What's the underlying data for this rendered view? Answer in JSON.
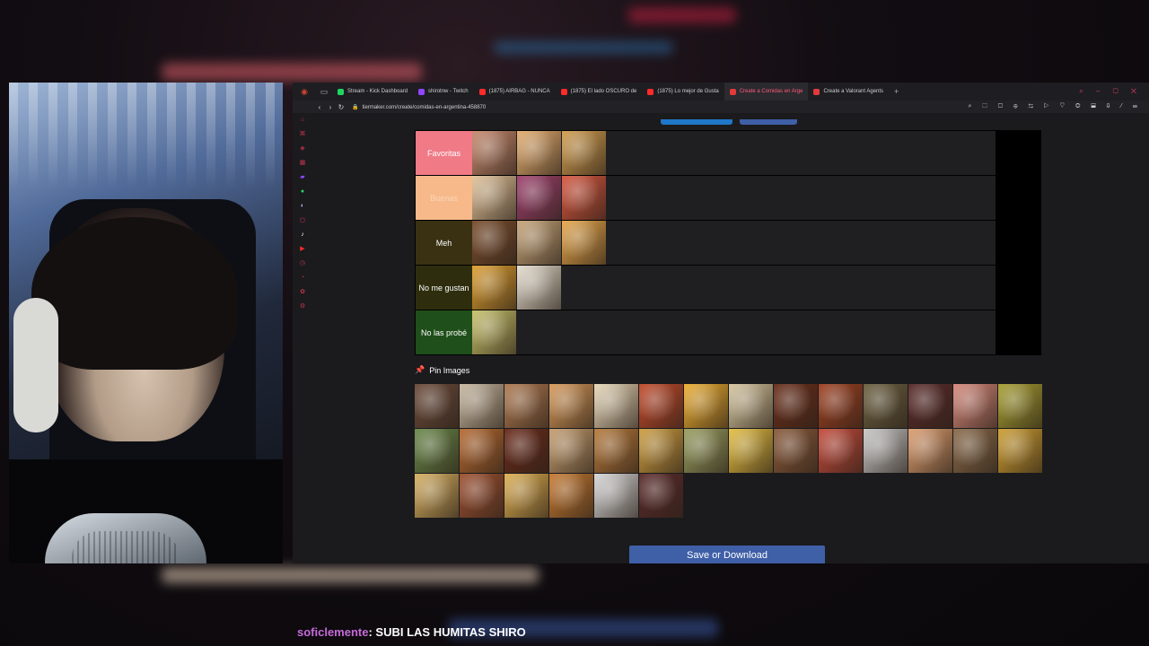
{
  "browser": {
    "tabs": [
      {
        "label": "Stream - Kick Dashboard",
        "fav": "#1ed760",
        "active": false
      },
      {
        "label": "shirotnw - Twitch",
        "fav": "#9146ff",
        "active": false
      },
      {
        "label": "(1875) AIRBAG - NUNCA",
        "fav": "#ff2a2a",
        "active": false
      },
      {
        "label": "(1875) El lado OSCURO de",
        "fav": "#ff2a2a",
        "active": false
      },
      {
        "label": "(1875) Lo mejor de Gusta",
        "fav": "#ff2a2a",
        "active": false
      },
      {
        "label": "Create a Comidas en Arge",
        "fav": "#e03a3a",
        "active": true
      },
      {
        "label": "Create a Valorant Agents",
        "fav": "#e03a3a",
        "active": false
      }
    ],
    "url": "tiermaker.com/create/comidas-en-argentina-458870"
  },
  "tiers": [
    {
      "label": "Favoritas",
      "color": "#f07a86",
      "items": [
        "#c88a6e",
        "#e8b070",
        "#d4a050"
      ]
    },
    {
      "label": "Buenas",
      "color": "#f7b98a",
      "items": [
        "#e3c49b",
        "#a0406e",
        "#d9563e"
      ]
    },
    {
      "label": "Meh",
      "color": "#3a3112",
      "items": [
        "#7a4d2d",
        "#c9a77a",
        "#e9a84a"
      ]
    },
    {
      "label": "No me gustan",
      "color": "#2e2e0f",
      "items": [
        "#e0a030",
        "#e8e0d0"
      ]
    },
    {
      "label": "No las probé",
      "color": "#1f4f1a",
      "items": [
        "#c9c36a"
      ]
    }
  ],
  "pin_images_label": "Pin Images",
  "pool_items": [
    "#6b4a3a",
    "#c8b8a0",
    "#b07a50",
    "#d99a5a",
    "#e8d8b8",
    "#c54a2a",
    "#f0b030",
    "#d8c8a0",
    "#6a2e1a",
    "#a04020",
    "#6b6040",
    "#5a2a2a",
    "#d8887a",
    "#a8a030",
    "#6a8a4a",
    "#b86a30",
    "#6a2a1a",
    "#c8a070",
    "#b87a3a",
    "#d0a040",
    "#9aa060",
    "#e8c040",
    "#8a5a3a",
    "#c84a3a",
    "#c8c8c8",
    "#e0a070",
    "#8a6a4a",
    "#d0a030",
    "#d8b060",
    "#a05030",
    "#e0b050",
    "#c87a30",
    "#d8d8d8",
    "#5a2a2a"
  ],
  "save_label": "Save or Download",
  "chat": {
    "user": "soficlemente",
    "message": ": SUBI LAS HUMITAS SHIRO"
  }
}
